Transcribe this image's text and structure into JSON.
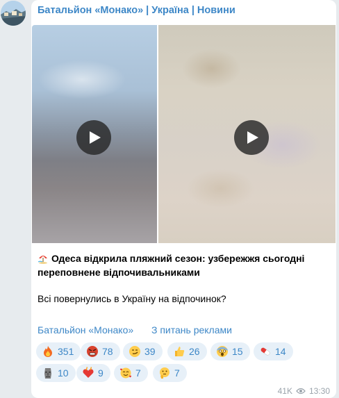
{
  "channel": {
    "title": "Батальйон «Монако» | Україна | Новини"
  },
  "message": {
    "headline": "Одеса відкрила пляжний сезон: узбережжя сьогодні переповнене відпочивальниками",
    "body": "Всі повернулись в Україну на відпочинок?",
    "views": "41K",
    "time": "13:30"
  },
  "links": {
    "channel_link": "Батальйон «Монако»",
    "ads_link": "З питань реклами"
  },
  "reactions": [
    {
      "icon": "fire-icon",
      "count": "351"
    },
    {
      "icon": "angry-face-icon",
      "count": "78"
    },
    {
      "icon": "smirk-face-icon",
      "count": "39"
    },
    {
      "icon": "thumbs-up-icon",
      "count": "26"
    },
    {
      "icon": "screaming-face-icon",
      "count": "15"
    },
    {
      "icon": "pill-icon",
      "count": "14"
    },
    {
      "icon": "moai-icon",
      "count": "10"
    },
    {
      "icon": "heart-on-fire-icon",
      "count": "9"
    },
    {
      "icon": "smiling-hearts-face-icon",
      "count": "7"
    },
    {
      "icon": "thinking-face-icon",
      "count": "7"
    }
  ],
  "colors": {
    "accent": "#3d87c7",
    "background": "#e7ebee",
    "reaction_bg": "#e7f0f8",
    "meta": "#9aa3ab"
  }
}
